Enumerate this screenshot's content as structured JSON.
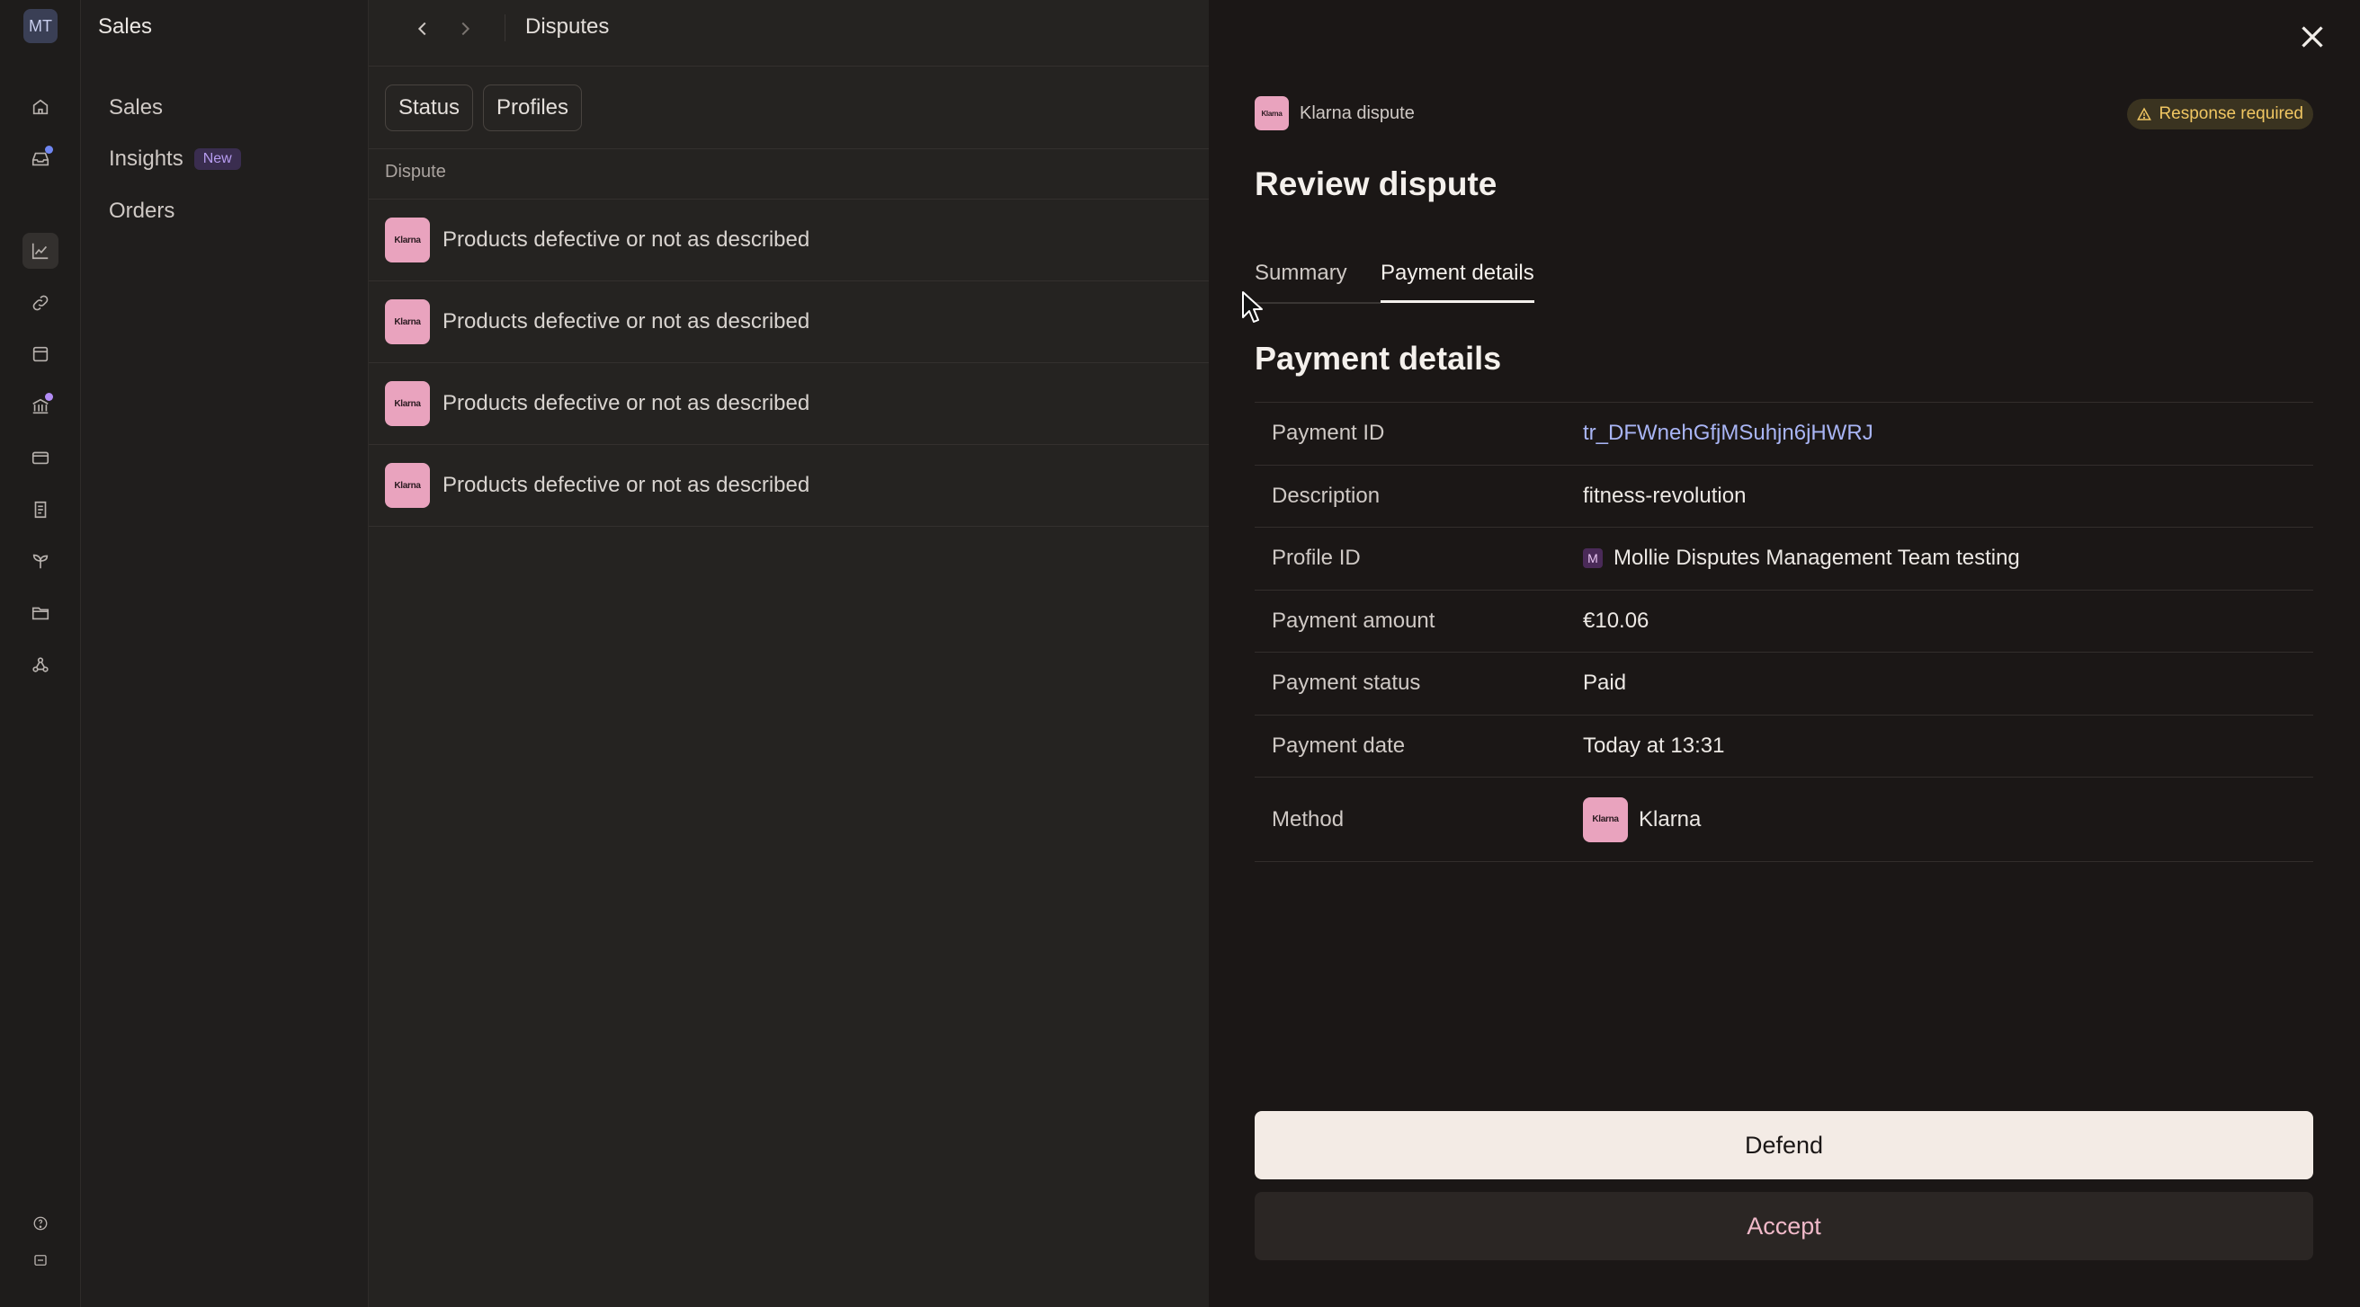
{
  "app": {
    "avatar_initials": "MT",
    "section_title": "Sales"
  },
  "rail_icons": [
    {
      "name": "home-icon",
      "active": false,
      "dot": null
    },
    {
      "name": "inbox-icon",
      "active": false,
      "dot": "#6f86f2"
    },
    {
      "name": "chart-icon",
      "active": true,
      "dot": null
    },
    {
      "name": "link-icon",
      "active": false,
      "dot": null
    },
    {
      "name": "store-icon",
      "active": false,
      "dot": null
    },
    {
      "name": "bank-icon",
      "active": false,
      "dot": "#b38cf5"
    },
    {
      "name": "card-icon",
      "active": false,
      "dot": null
    },
    {
      "name": "receipt-icon",
      "active": false,
      "dot": null
    },
    {
      "name": "plant-icon",
      "active": false,
      "dot": null
    },
    {
      "name": "folder-icon",
      "active": false,
      "dot": null
    },
    {
      "name": "apps-icon",
      "active": false,
      "dot": null
    },
    {
      "name": "help-icon",
      "active": false,
      "dot": null
    },
    {
      "name": "panel-icon",
      "active": false,
      "dot": null
    }
  ],
  "subnav": {
    "items": [
      {
        "label": "Sales",
        "badge": ""
      },
      {
        "label": "Insights",
        "badge": "New"
      },
      {
        "label": "Orders",
        "badge": ""
      }
    ]
  },
  "main": {
    "breadcrumb": "Disputes",
    "filters": [
      "Status",
      "Profiles"
    ],
    "column_header": "Dispute",
    "rows": [
      {
        "logo": "Klarna",
        "text": "Products defective or not as described"
      },
      {
        "logo": "Klarna",
        "text": "Products defective or not as described"
      },
      {
        "logo": "Klarna",
        "text": "Products defective or not as described"
      },
      {
        "logo": "Klarna",
        "text": "Products defective or not as described"
      }
    ]
  },
  "panel": {
    "logo": "Klarna",
    "header_label": "Klarna dispute",
    "status_badge": "Response required",
    "title": "Review dispute",
    "tabs": [
      {
        "label": "Summary",
        "active": false
      },
      {
        "label": "Payment details",
        "active": true
      }
    ],
    "section_title": "Payment details",
    "details": [
      {
        "label": "Payment ID",
        "value": "tr_DFWnehGfjMSuhjn6jHWRJ"
      },
      {
        "label": "Description",
        "value": "fitness-revolution"
      },
      {
        "label": "Profile ID",
        "value": "Mollie Disputes Management Team testing",
        "badge": "M"
      },
      {
        "label": "Payment amount",
        "value": "€10.06"
      },
      {
        "label": "Payment status",
        "value": "Paid"
      },
      {
        "label": "Payment date",
        "value": "Today at 13:31"
      },
      {
        "label": "Method",
        "value": "Klarna",
        "logo": "Klarna"
      }
    ],
    "defend_label": "Defend",
    "accept_label": "Accept"
  },
  "colors": {
    "accent_link": "#a9b5f5",
    "klarna_pink": "#e9a3be",
    "warning": "#f0c662",
    "accept_text": "#f0b9c9"
  }
}
